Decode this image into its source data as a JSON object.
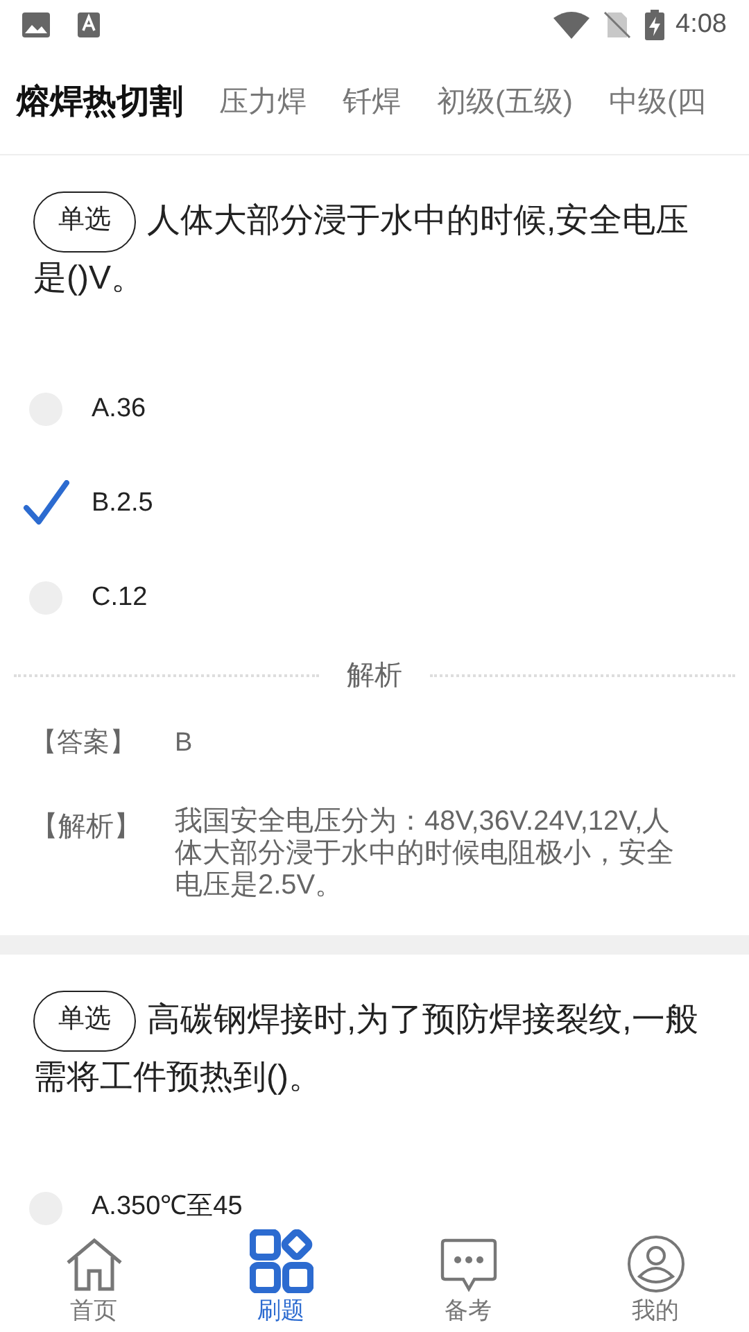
{
  "status_bar": {
    "time": "4:08"
  },
  "tabs": [
    {
      "label": "熔焊热切割",
      "selected": true
    },
    {
      "label": "压力焊",
      "selected": false
    },
    {
      "label": "钎焊",
      "selected": false
    },
    {
      "label": "初级(五级)",
      "selected": false
    },
    {
      "label": "中级(四",
      "selected": false
    }
  ],
  "questions": [
    {
      "type_tag": "单选",
      "text": "人体大部分浸于水中的时候,安全电压是()V。",
      "options": [
        {
          "label": "A.36",
          "selected": false
        },
        {
          "label": "B.2.5",
          "selected": true
        },
        {
          "label": "C.12",
          "selected": false
        }
      ],
      "analysis": {
        "heading": "解析",
        "answer_label": "【答案】",
        "answer": "B",
        "explanation_label": "【解析】",
        "explanation": "我国安全电压分为：48V,36V.24V,12V,人体大部分浸于水中的时候电阻极小，安全电压是2.5V。"
      }
    },
    {
      "type_tag": "单选",
      "text": "高碳钢焊接时,为了预防焊接裂纹,一般需将工件预热到()。",
      "options": [
        {
          "label": "A.350℃至45",
          "selected": false
        }
      ]
    }
  ],
  "bottom_nav": [
    {
      "label": "首页",
      "selected": false
    },
    {
      "label": "刷题",
      "selected": true
    },
    {
      "label": "备考",
      "selected": false
    },
    {
      "label": "我的",
      "selected": false
    }
  ]
}
